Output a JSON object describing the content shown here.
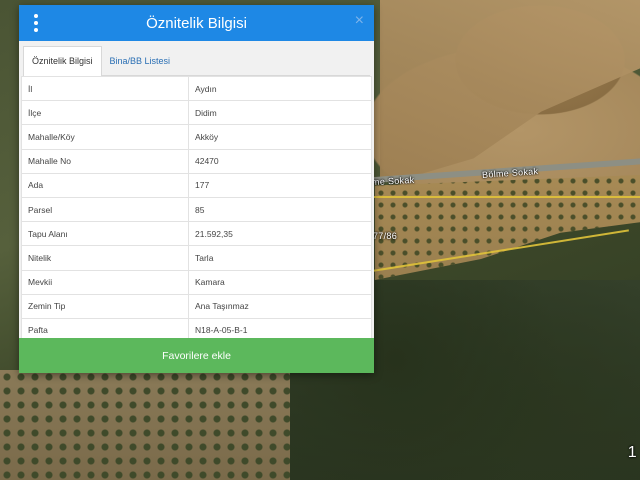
{
  "dialog": {
    "title": "Öznitelik Bilgisi",
    "close_symbol": "×",
    "menu_icon": "vertical-dots-icon",
    "tabs": [
      {
        "label": "Öznitelik Bilgisi",
        "active": true
      },
      {
        "label": "Bina/BB Listesi",
        "active": false
      }
    ],
    "rows": [
      {
        "key": "İl",
        "value": "Aydın"
      },
      {
        "key": "İlçe",
        "value": "Didim"
      },
      {
        "key": "Mahalle/Köy",
        "value": "Akköy"
      },
      {
        "key": "Mahalle No",
        "value": "42470"
      },
      {
        "key": "Ada",
        "value": "177"
      },
      {
        "key": "Parsel",
        "value": "85"
      },
      {
        "key": "Tapu Alanı",
        "value": "21.592,35"
      },
      {
        "key": "Nitelik",
        "value": "Tarla"
      },
      {
        "key": "Mevkii",
        "value": "Kamara"
      },
      {
        "key": "Zemin Tip",
        "value": "Ana Taşınmaz"
      },
      {
        "key": "Pafta",
        "value": "N18-A-05-B-1"
      }
    ],
    "favorite_button": "Favorilere ekle"
  },
  "map": {
    "street_label_left": "me Sokak",
    "street_label_right": "Bölme Sokak",
    "parcel_label": "77/86",
    "corner_text": "1"
  },
  "colors": {
    "header": "#1e88e5",
    "favorite_button": "#5cb85c",
    "parcel_outline": "#e0c23a"
  }
}
